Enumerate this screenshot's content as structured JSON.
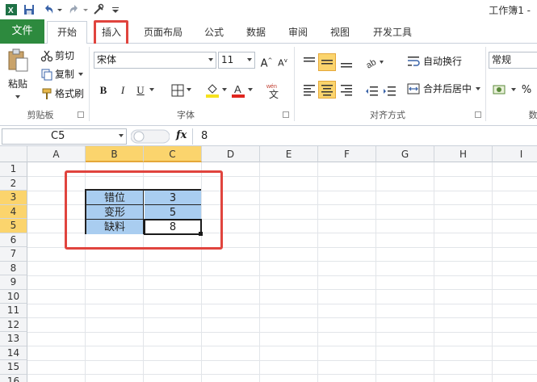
{
  "app": {
    "title": "工作簿1 -"
  },
  "tabs": [
    "文件",
    "开始",
    "插入",
    "页面布局",
    "公式",
    "数据",
    "审阅",
    "视图",
    "开发工具"
  ],
  "ribbon": {
    "clipboard": {
      "paste": "粘贴",
      "cut": "剪切",
      "copy": "复制",
      "format_painter": "格式刷",
      "group_label": "剪贴板"
    },
    "font": {
      "font_name": "宋体",
      "font_size": "11",
      "bold": "B",
      "italic": "I",
      "underline": "U",
      "group_label": "字体"
    },
    "alignment": {
      "wrap_text": "自动换行",
      "merge_center": "合并后居中",
      "group_label": "对齐方式"
    },
    "number": {
      "format": "常规",
      "group_label": "数"
    }
  },
  "formula_bar": {
    "cell_ref": "C5",
    "fx": "fx",
    "value": "8"
  },
  "grid": {
    "columns": [
      "A",
      "B",
      "C",
      "D",
      "E",
      "F",
      "G",
      "H",
      "I"
    ],
    "rows": [
      "1",
      "2",
      "3",
      "4",
      "5",
      "6",
      "7",
      "8",
      "9",
      "10",
      "11",
      "12",
      "13",
      "14",
      "15",
      "16"
    ],
    "selected_column": "C",
    "selected_rows": [
      "3",
      "4",
      "5"
    ],
    "table": [
      {
        "label": "错位",
        "value": "3"
      },
      {
        "label": "变形",
        "value": "5"
      },
      {
        "label": "缺料",
        "value": "8"
      }
    ]
  },
  "colors": {
    "file_tab": "#2d8a3e",
    "highlight": "#e0443e",
    "selection_fill": "#a9cdf0",
    "header_selected": "#fbd46d"
  }
}
